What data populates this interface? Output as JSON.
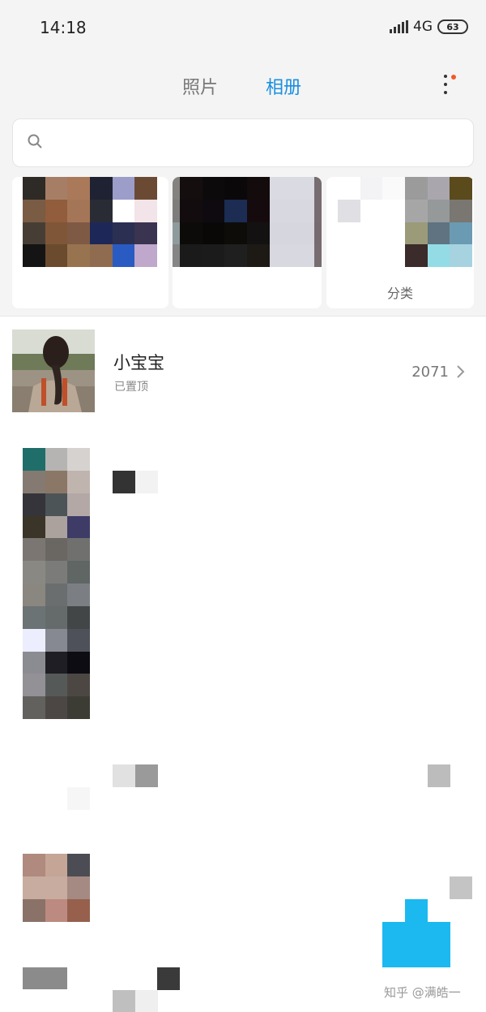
{
  "status_bar": {
    "time": "14:18",
    "network": "4G",
    "battery": "63"
  },
  "header": {
    "tabs": [
      {
        "label": "照片",
        "active": false
      },
      {
        "label": "相册",
        "active": true
      }
    ],
    "more_icon": "more-vertical-icon",
    "badge_color": "#f05a28"
  },
  "search": {
    "placeholder": "",
    "icon": "search-icon"
  },
  "categories": [
    {
      "label": ""
    },
    {
      "label": ""
    },
    {
      "label": "分类"
    }
  ],
  "albums": [
    {
      "name": "小宝宝",
      "subtitle": "已置顶",
      "count": "2071"
    }
  ],
  "watermark": "知乎 @满皓一",
  "colors": {
    "accent": "#1a8fe0",
    "header_bg": "#f4f4f4",
    "fab": "#1bb9f0"
  }
}
